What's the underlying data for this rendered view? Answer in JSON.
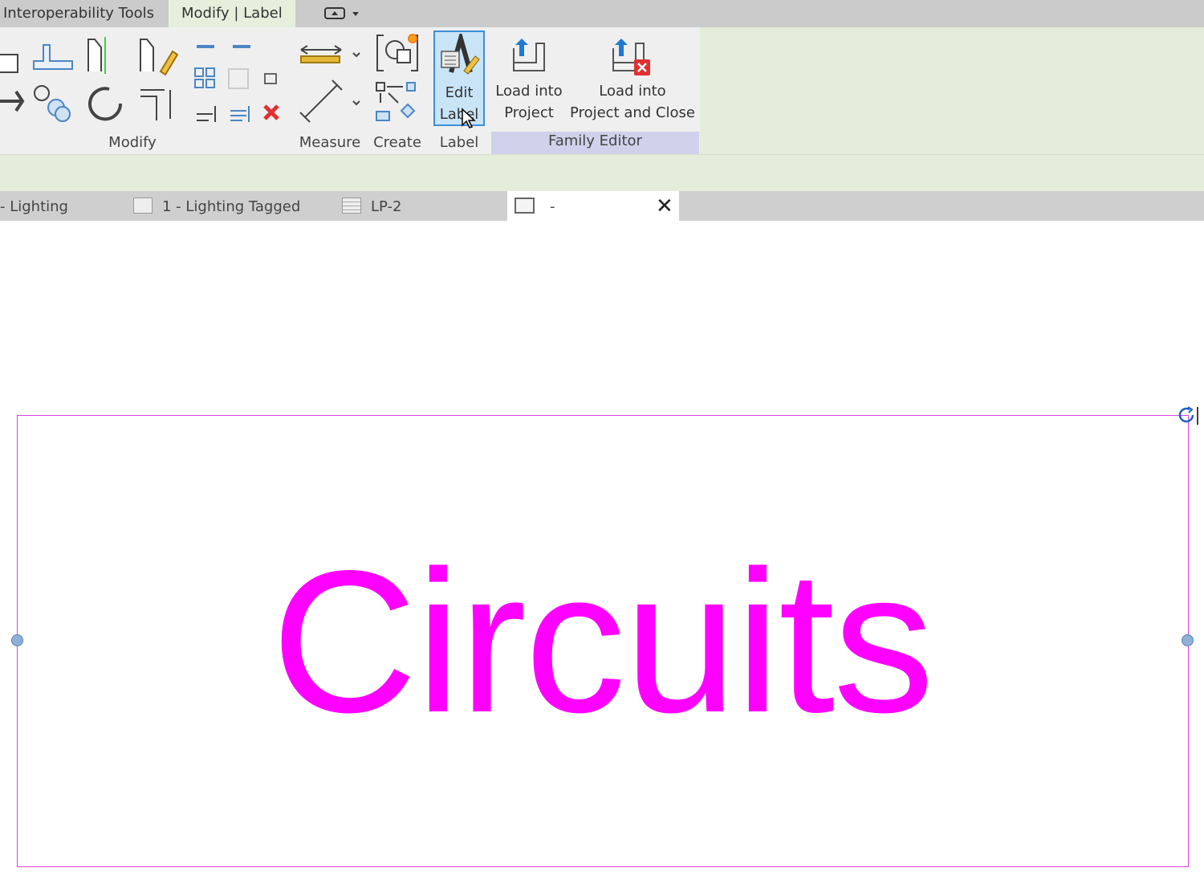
{
  "ribbon_tabs": [
    {
      "label": "Interoperability Tools",
      "active": false
    },
    {
      "label": "Modify | Label",
      "active": true
    }
  ],
  "quick_access": {
    "icon": "minimize-ribbon-icon"
  },
  "panels": {
    "modify": "Modify",
    "measure": "Measure",
    "create": "Create",
    "label": "Label",
    "family_editor": "Family Editor"
  },
  "buttons": {
    "edit_label": [
      "Edit",
      "Label"
    ],
    "load_into_project": [
      "Load into",
      "Project"
    ],
    "load_into_project_close": [
      "Load into",
      "Project and Close"
    ]
  },
  "view_tabs": [
    {
      "label": "- Lighting",
      "icon": "none"
    },
    {
      "label": "1 - Lighting Tagged",
      "icon": "sheet-icon"
    },
    {
      "label": "LP-2",
      "icon": "schedule-icon"
    },
    {
      "label": "-",
      "icon": "family-view-icon",
      "active": true
    }
  ],
  "canvas": {
    "label_text": "Circuits",
    "label_color": "#ff00ff"
  },
  "colors": {
    "ribbon_green": "#e3edd9",
    "selection": "#c9e4f7",
    "family_editor_panel": "#cfd2ea"
  }
}
